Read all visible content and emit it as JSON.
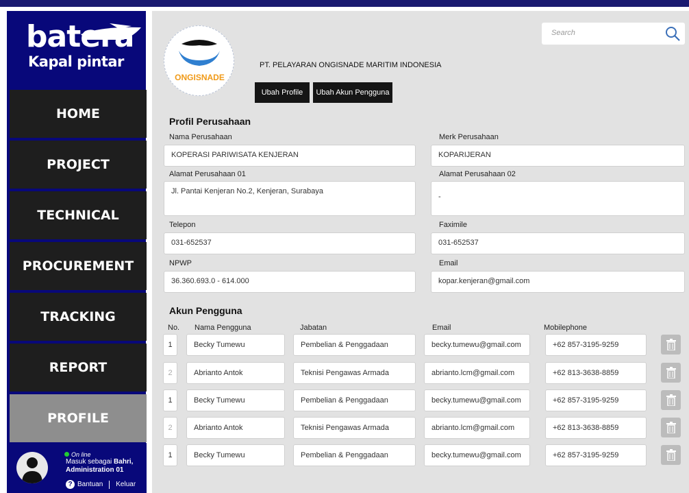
{
  "brand": {
    "name": "batera",
    "tagline": "Kapal pintar"
  },
  "nav": [
    {
      "label": "HOME",
      "active": false
    },
    {
      "label": "PROJECT",
      "active": false
    },
    {
      "label": "TECHNICAL",
      "active": false
    },
    {
      "label": "PROCUREMENT",
      "active": false
    },
    {
      "label": "TRACKING",
      "active": false
    },
    {
      "label": "REPORT",
      "active": false
    },
    {
      "label": "PROFILE",
      "active": true
    }
  ],
  "user": {
    "status": "On line",
    "logged_as_prefix": "Masuk sebagai",
    "name": "Bahri,",
    "role": "Administration 01",
    "help_label": "Bantuan",
    "logout_label": "Keluar"
  },
  "search": {
    "placeholder": "Search"
  },
  "company": {
    "logo_text": "ONGISNADE",
    "full_name": "PT. PELAYARAN ONGISNADE MARITIM INDONESIA",
    "edit_profile_label": "Ubah Profile",
    "edit_accounts_label": "Ubah Akun Pengguna"
  },
  "profile": {
    "title": "Profil Perusahaan",
    "fields": {
      "nama_label": "Nama Perusahaan",
      "nama_value": "KOPERASI PARIWISATA KENJERAN",
      "merk_label": "Merk Perusahaan",
      "merk_value": "KOPARIJERAN",
      "alamat1_label": "Alamat Perusahaan 01",
      "alamat1_value": "Jl. Pantai Kenjeran No.2, Kenjeran, Surabaya",
      "alamat2_label": "Alamat Perusahaan 02",
      "alamat2_value": "-",
      "telepon_label": "Telepon",
      "telepon_value": "031-652537",
      "fax_label": "Faximile",
      "fax_value": "031-652537",
      "npwp_label": "NPWP",
      "npwp_value": "36.360.693.0 - 614.000",
      "email_label": "Email",
      "email_value": "kopar.kenjeran@gmail.com"
    }
  },
  "accounts": {
    "title": "Akun Pengguna",
    "headers": {
      "no": "No.",
      "name": "Nama Pengguna",
      "position": "Jabatan",
      "email": "Email",
      "mobile": "Mobilephone"
    },
    "rows": [
      {
        "no": "1",
        "name": "Becky Tumewu",
        "position": "Pembelian & Penggadaan",
        "email": "becky.tumewu@gmail.com",
        "mobile": "+62 857-3195-9259"
      },
      {
        "no": "2",
        "name": "Abrianto Antok",
        "position": "Teknisi Pengawas Armada",
        "email": "abrianto.lcm@gmail.com",
        "mobile": "+62 813-3638-8859"
      },
      {
        "no": "1",
        "name": "Becky Tumewu",
        "position": "Pembelian & Penggadaan",
        "email": "becky.tumewu@gmail.com",
        "mobile": "+62 857-3195-9259"
      },
      {
        "no": "2",
        "name": "Abrianto Antok",
        "position": "Teknisi Pengawas Armada",
        "email": "abrianto.lcm@gmail.com",
        "mobile": "+62 813-3638-8859"
      },
      {
        "no": "1",
        "name": "Becky Tumewu",
        "position": "Pembelian & Penggadaan",
        "email": "becky.tumewu@gmail.com",
        "mobile": "+62 857-3195-9259"
      }
    ]
  },
  "colors": {
    "sidebar": "#08087a",
    "nav_bg": "#1e1e1e",
    "nav_active": "#8e8e8e",
    "main_bg": "#e2e2e2",
    "accent_orange": "#f09a18",
    "logo_blue": "#2f7fd0"
  },
  "icons": [
    "ship-logo",
    "search-icon",
    "trash-icon",
    "help-icon",
    "user-avatar-icon",
    "online-dot"
  ]
}
